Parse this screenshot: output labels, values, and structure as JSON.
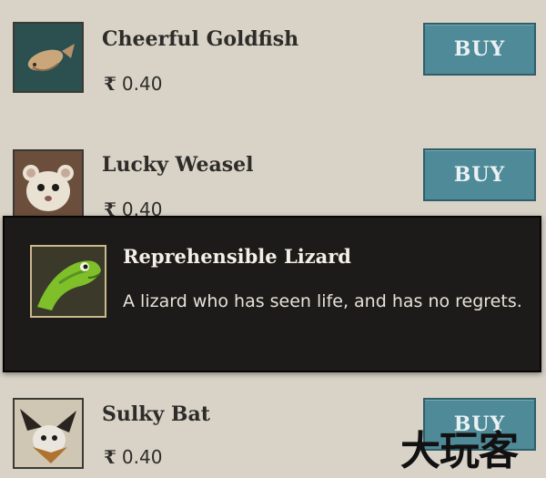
{
  "shop": {
    "items": [
      {
        "name": "Cheerful Goldfish",
        "currency_symbol": "₹",
        "price": "0.40",
        "buy_label": "BUY",
        "portrait": "goldfish-icon"
      },
      {
        "name": "Lucky Weasel",
        "currency_symbol": "₹",
        "price": "0.40",
        "buy_label": "BUY",
        "portrait": "weasel-icon"
      },
      {
        "name": "Sulky Bat",
        "currency_symbol": "₹",
        "price": "0.40",
        "buy_label": "BUY",
        "portrait": "bat-icon"
      }
    ]
  },
  "tooltip": {
    "title": "Reprehensible Lizard",
    "description": "A lizard who has seen life, and has no regrets.",
    "portrait": "lizard-icon"
  },
  "watermark": {
    "text": "大玩客"
  },
  "colors": {
    "background": "#d9d3c7",
    "buy_button": "#4f8a98",
    "tooltip_bg": "#1c1b19"
  }
}
